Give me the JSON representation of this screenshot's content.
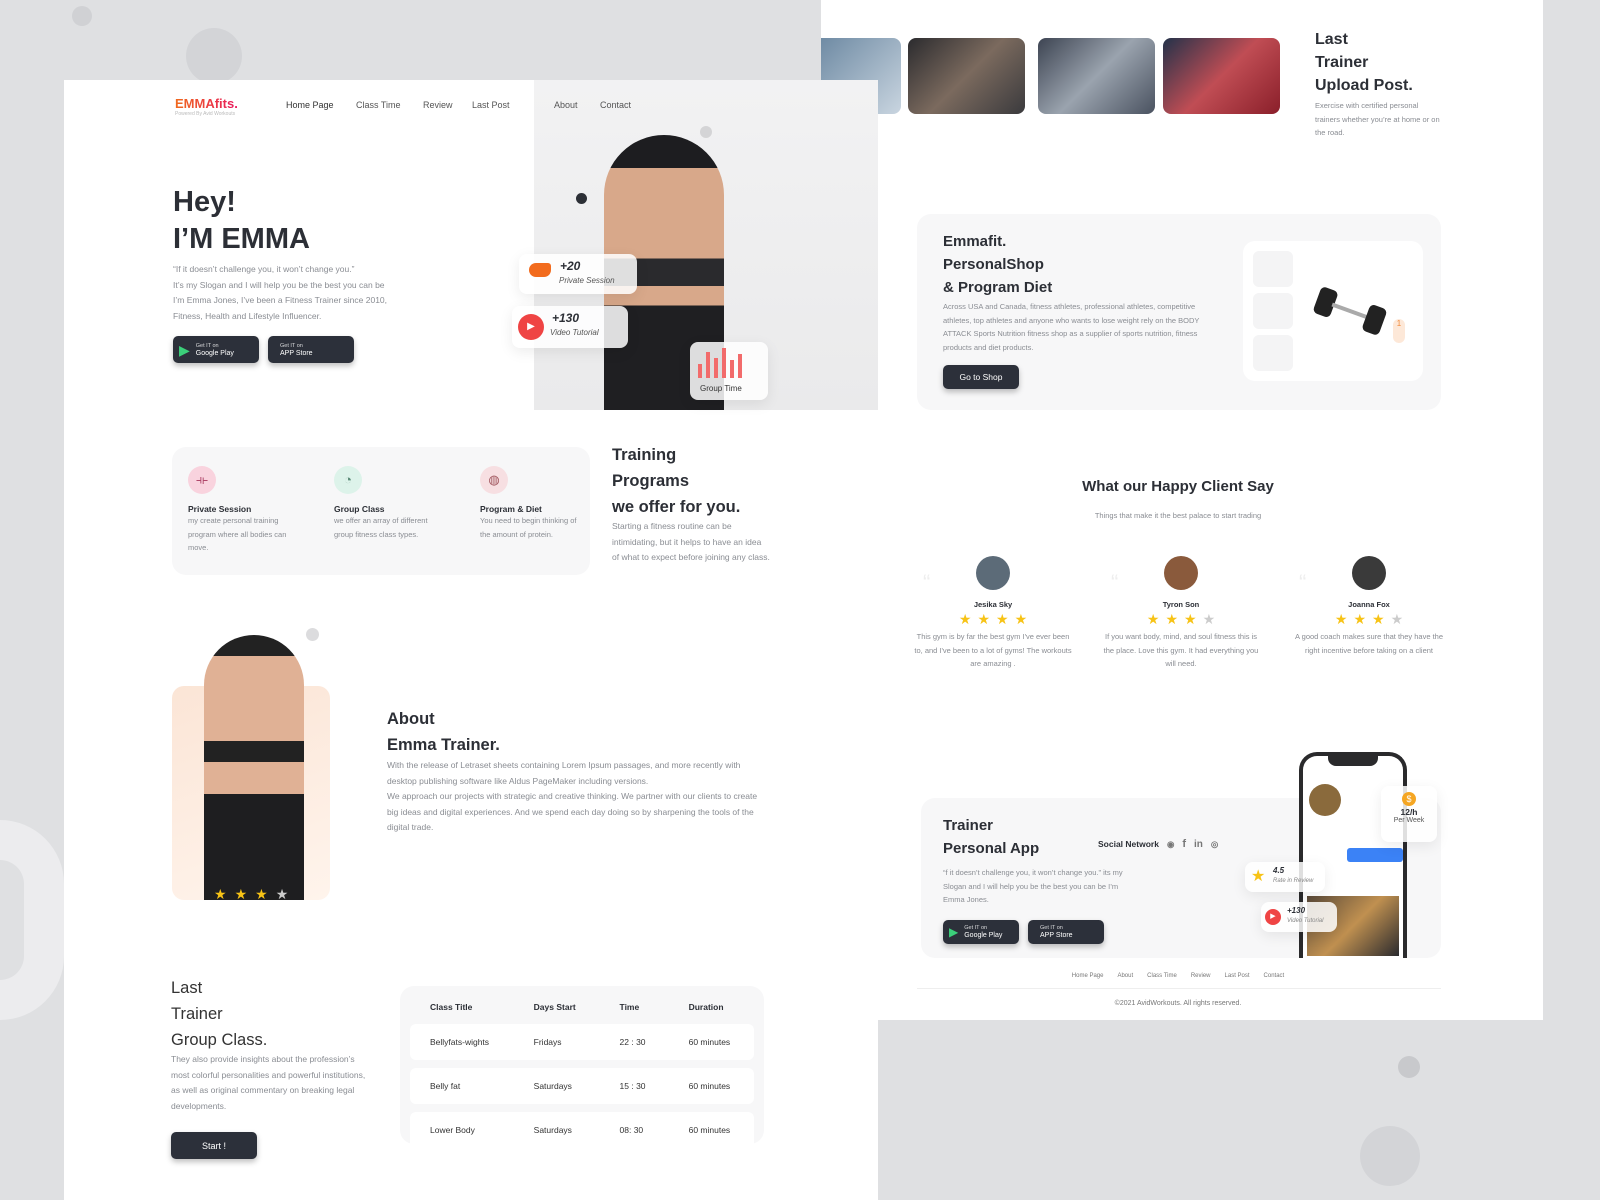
{
  "brand": {
    "name": "EMMAfits.",
    "tagline": "Powered By Avid Workouts"
  },
  "nav": [
    "Home Page",
    "Class Time",
    "Review",
    "Last Post",
    "About",
    "Contact"
  ],
  "hero": {
    "title1": "Hey!",
    "title2": "I’M EMMA",
    "lines": [
      "“If it doesn’t challenge you, it won’t change you.”",
      "It’s my Slogan and I will help you be the best you can be",
      "I’m Emma Jones, I’ve been a Fitness Trainer since 2010,",
      "Fitness, Health and Lifestyle Influencer."
    ],
    "google": {
      "small": "Get IT on",
      "label": "Google Play"
    },
    "apple": {
      "small": "Get IT on",
      "label": "APP Store"
    },
    "badge1": {
      "value": "+20",
      "label": "Private Session"
    },
    "badge2": {
      "value": "+130",
      "label": "Video Tutorial"
    },
    "badge3": {
      "label": "Group Time"
    }
  },
  "programs": {
    "items": [
      {
        "title": "Private Session",
        "desc": "my create  personal training program where all bodies can move."
      },
      {
        "title": "Group Class",
        "desc": "we offer an array of different group fitness class types."
      },
      {
        "title": "Program & Diet",
        "desc": "You need to begin thinking of  the amount of protein."
      }
    ],
    "title": [
      "Training",
      "Programs",
      "we offer for you."
    ],
    "desc": "Starting a fitness routine can be intimidating, but it helps to have an idea of what to expect before joining any class."
  },
  "about": {
    "title": [
      "About",
      "Emma Trainer."
    ],
    "desc1": "With the release of Letraset sheets containing Lorem Ipsum passages, and more recently with desktop publishing software like Aldus PageMaker including versions.",
    "desc2": "We approach our projects with strategic and creative thinking. We partner with our clients to create big ideas and digital experiences. And we spend each day doing so by sharpening the tools of the digital trade.",
    "rating": 3
  },
  "group": {
    "title": [
      "Last",
      "Trainer",
      "Group Class."
    ],
    "desc": "They also provide insights about the profession’s most colorful personalities and powerful institutions, as well as original commentary on breaking legal developments.",
    "start": "Start !",
    "headers": [
      "Class Title",
      "Days Start",
      "Time",
      "Duration"
    ],
    "rows": [
      [
        "Bellyfats-wights",
        "Fridays",
        "22 : 30",
        "60 minutes"
      ],
      [
        "Belly fat",
        "Saturdays",
        "15 : 30",
        "60 minutes"
      ],
      [
        "Lower Body",
        "Saturdays",
        "08: 30",
        "60 minutes"
      ]
    ]
  },
  "upload": {
    "title": [
      "Last",
      "Trainer",
      "Upload Post."
    ],
    "desc": "Exercise with certified personal trainers whether you’re at home or on the road."
  },
  "shop": {
    "title": [
      "Emmafit.",
      "PersonalShop",
      "& Program Diet"
    ],
    "desc": "Across USA and Canada, fitness athletes, professional athletes, competitive athletes, top athletes and anyone who wants to lose weight rely on the BODY ATTACK Sports Nutrition fitness shop as a supplier of sports nutrition, fitness products and diet products.",
    "button": "Go to Shop",
    "qty": "1"
  },
  "clients": {
    "title": "What our Happy Client Say",
    "subtitle": "Things that make it the best palace to start trading",
    "items": [
      {
        "name": "Jesika Sky",
        "rating": 4,
        "text": "This gym is by far the best gym I've ever been to, and I've been to a lot of gyms! The workouts are amazing ."
      },
      {
        "name": "Tyron Son",
        "rating": 3,
        "text": "If you want body, mind, and soul fitness this is the place. Love this gym. It had everything you will need."
      },
      {
        "name": "Joanna Fox",
        "rating": 3,
        "text": "A good coach makes sure that they have the right incentive before taking on a client"
      }
    ]
  },
  "app": {
    "title": [
      "Trainer",
      "Personal App"
    ],
    "social": "Social Network",
    "desc": "“f it doesn’t challenge you, it won’t change you.”  its my Slogan and I will help you be the best you can be I’m Emma Jones.",
    "rate": {
      "value": "4.5",
      "label": "Rate in Review"
    },
    "video": {
      "value": "+130",
      "label": "Video Tutorial"
    },
    "price": {
      "value": "12/h",
      "label": "Per Week"
    }
  },
  "footer": {
    "links": [
      "Home Page",
      "About",
      "Class Time",
      "Review",
      "Last Post",
      "Contact"
    ],
    "copyright": "©2021 AvidWorkouts. All rights reserved."
  }
}
